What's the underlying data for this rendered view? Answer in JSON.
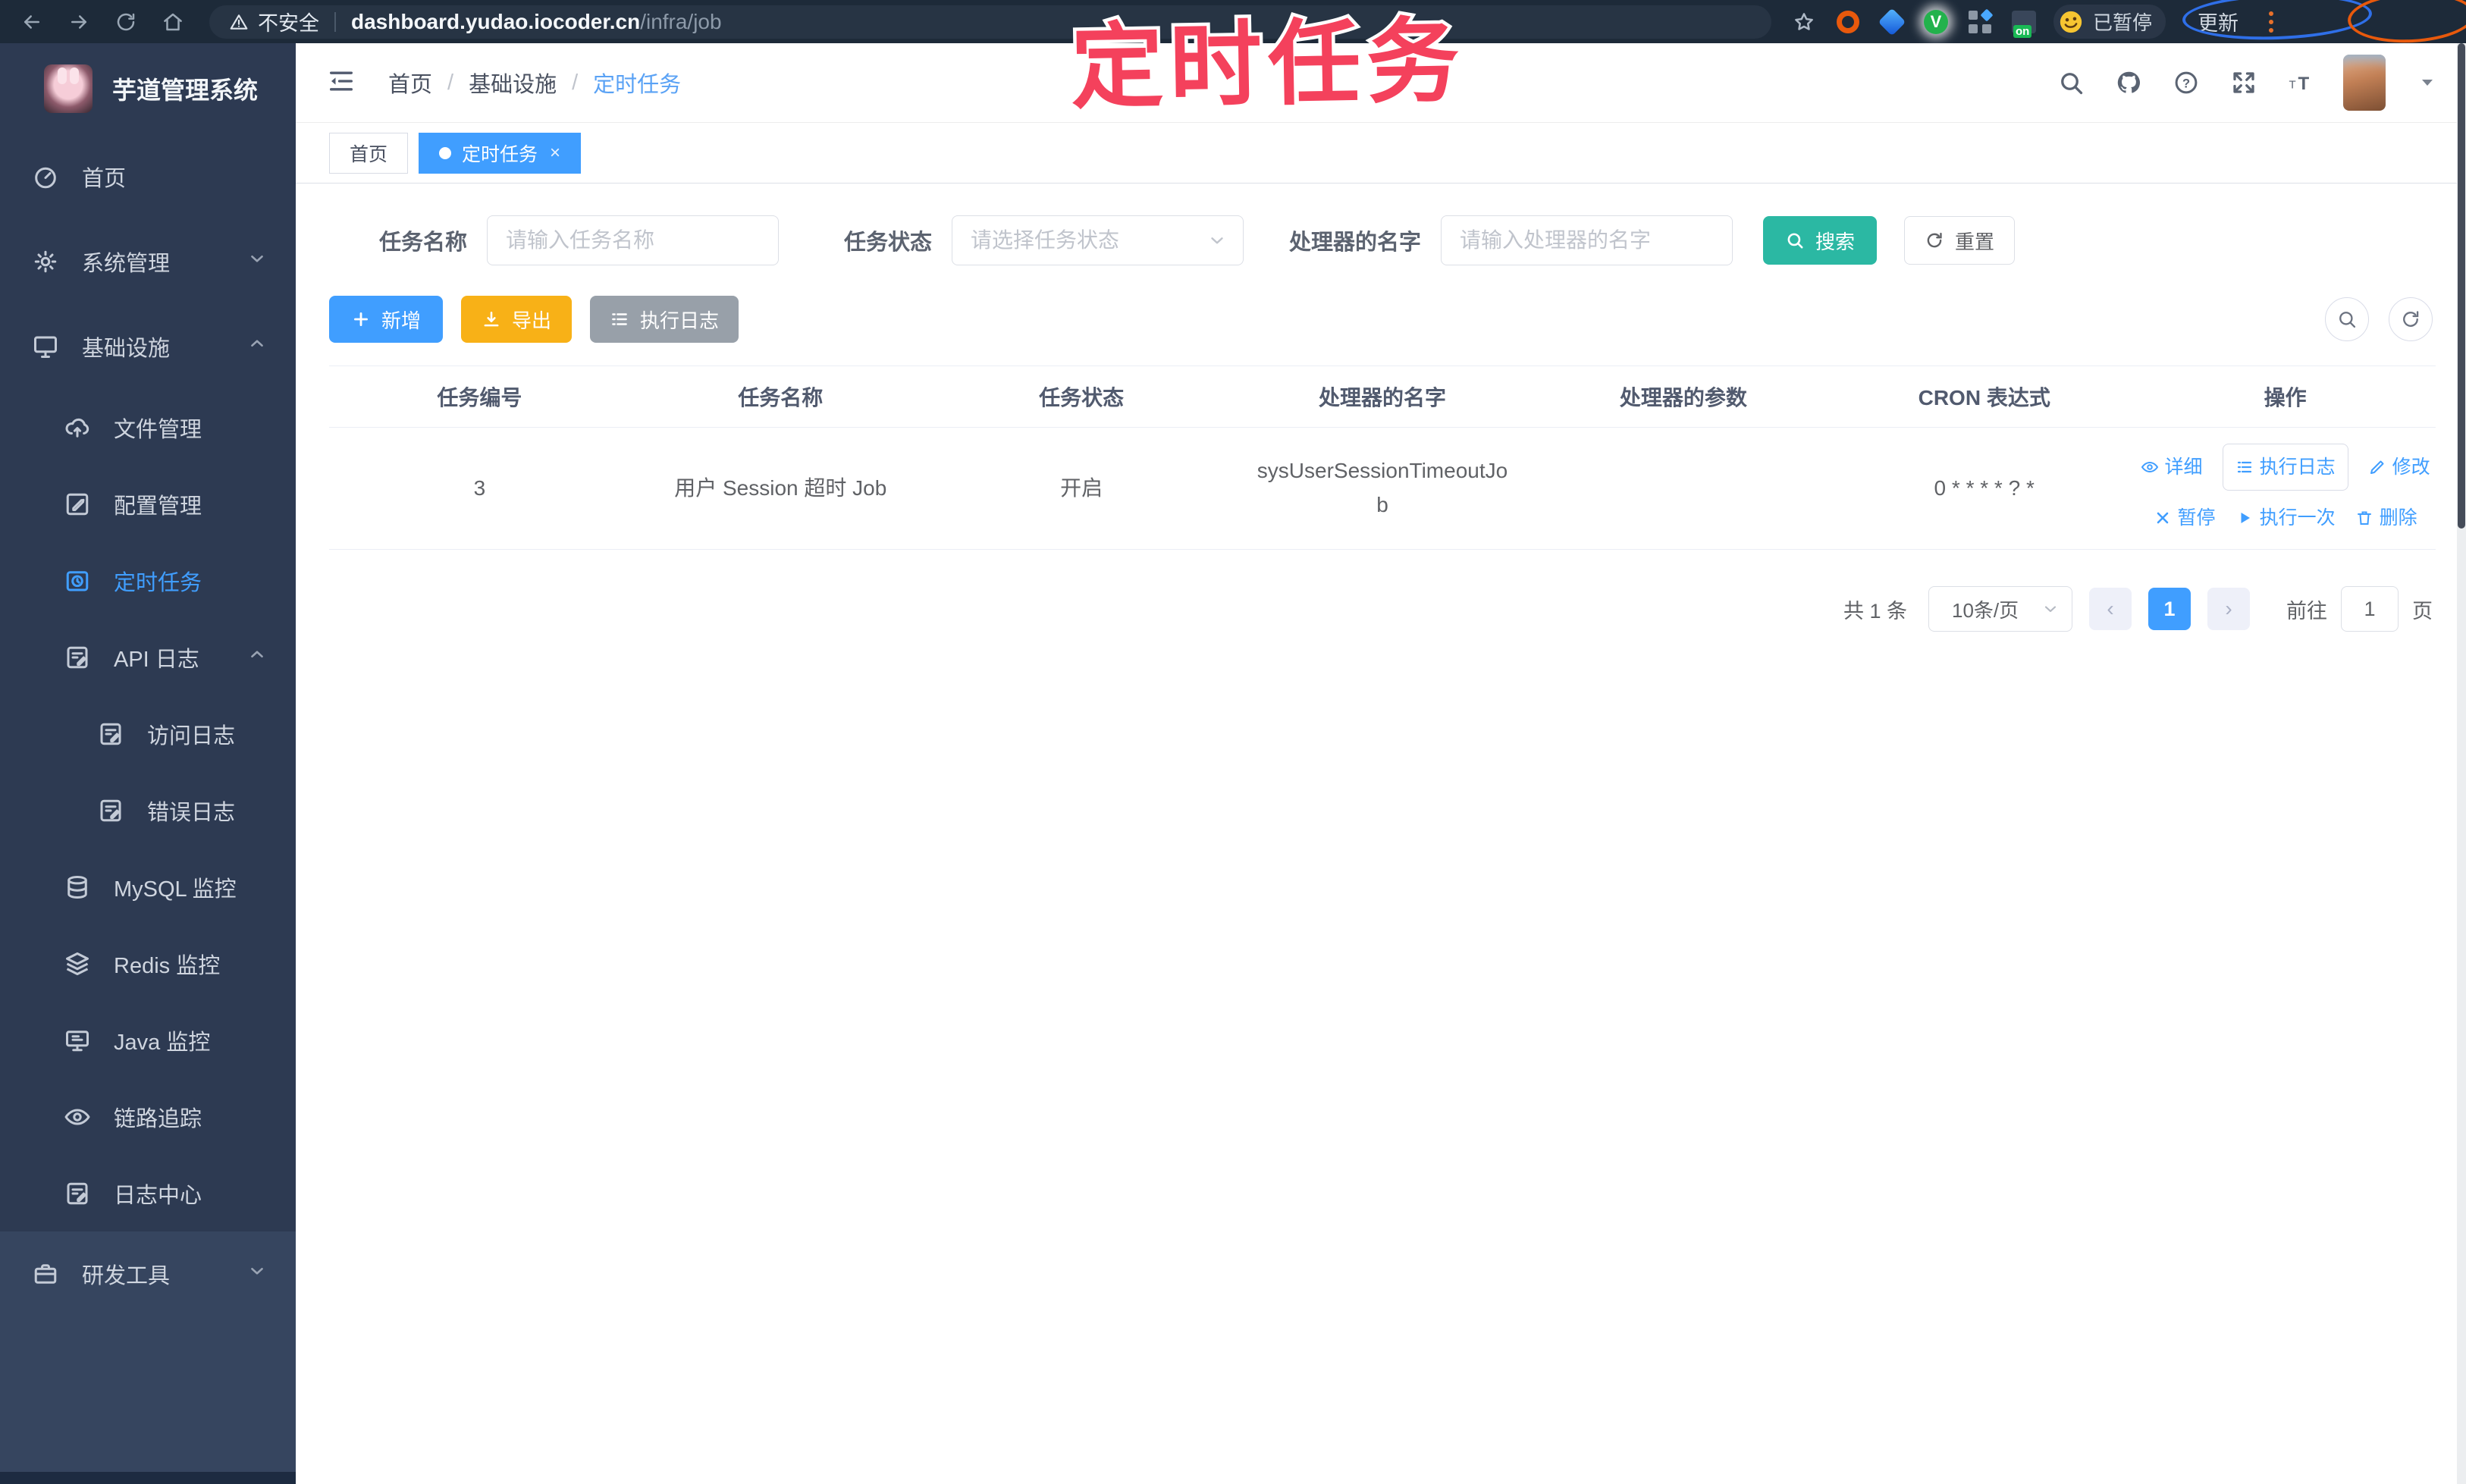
{
  "annotation": {
    "title": "定时任务"
  },
  "browser": {
    "security": "不安全",
    "url_host": "dashboard.yudao.iocoder.cn",
    "url_path": "/infra/job",
    "paused_badge": "已暂停",
    "update_label": "更新"
  },
  "sidebar": {
    "title": "芋道管理系统",
    "items": [
      {
        "label": "首页"
      },
      {
        "label": "系统管理"
      },
      {
        "label": "基础设施"
      },
      {
        "label": "文件管理"
      },
      {
        "label": "配置管理"
      },
      {
        "label": "定时任务"
      },
      {
        "label": "API 日志"
      },
      {
        "label": "访问日志"
      },
      {
        "label": "错误日志"
      },
      {
        "label": "MySQL 监控"
      },
      {
        "label": "Redis 监控"
      },
      {
        "label": "Java 监控"
      },
      {
        "label": "链路追踪"
      },
      {
        "label": "日志中心"
      },
      {
        "label": "研发工具"
      }
    ]
  },
  "breadcrumb": {
    "items": [
      "首页",
      "基础设施",
      "定时任务"
    ],
    "sep": "/"
  },
  "tabs": [
    {
      "label": "首页"
    },
    {
      "label": "定时任务"
    }
  ],
  "filters": {
    "name_label": "任务名称",
    "name_placeholder": "请输入任务名称",
    "status_label": "任务状态",
    "status_placeholder": "请选择任务状态",
    "handler_label": "处理器的名字",
    "handler_placeholder": "请输入处理器的名字",
    "search": "搜索",
    "reset": "重置"
  },
  "toolbar": {
    "add": "新增",
    "export": "导出",
    "exec_log": "执行日志"
  },
  "table": {
    "columns": [
      "任务编号",
      "任务名称",
      "任务状态",
      "处理器的名字",
      "处理器的参数",
      "CRON 表达式",
      "操作"
    ],
    "row": {
      "id": "3",
      "name": "用户 Session 超时 Job",
      "status": "开启",
      "handler": "sysUserSessionTimeoutJob",
      "params": "",
      "cron": "0 * * * * ? *",
      "ops": [
        "详细",
        "执行日志",
        "修改",
        "暂停",
        "执行一次",
        "删除"
      ]
    }
  },
  "pagination": {
    "total": "共 1 条",
    "page_size": "10条/页",
    "page": "1",
    "goto_prefix": "前往",
    "goto_value": "1",
    "goto_suffix": "页"
  },
  "colors": {
    "primary": "#409eff",
    "search_teal": "#2bb8a3",
    "export_yellow": "#f8b117",
    "annotation_pink": "#f4415c"
  }
}
